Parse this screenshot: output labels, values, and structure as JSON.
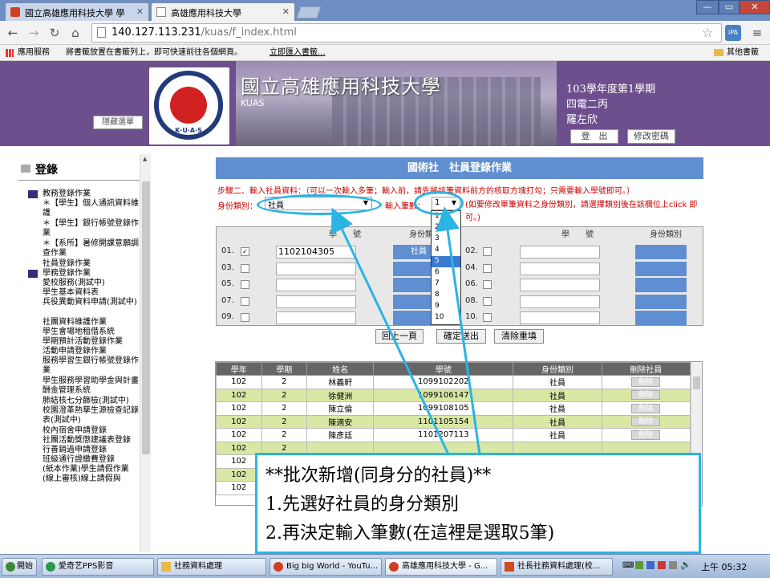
{
  "browser": {
    "tabs": [
      {
        "label": "國立高雄應用科技大學 學",
        "active": false
      },
      {
        "label": "高雄應用科技大學",
        "active": true
      }
    ],
    "window_buttons": [
      "—",
      "▭",
      "✕"
    ],
    "url_host": "140.127.113.231",
    "url_path": "/kuas/f_index.html",
    "bookmarks_bar": {
      "apps": "應用服務",
      "hint": "將書籤放置在書籤列上，即可快速前往各個網頁。",
      "import": "立即匯入書籤...",
      "other": "其他書籤"
    }
  },
  "banner": {
    "hide_menu": "隱藏選單",
    "uni_name": "國立高雄應用科技大學",
    "uni_abbr": "KUAS",
    "logo_letters": "K·U·A·S",
    "term": "103學年度第1學期",
    "class": "四電二丙",
    "user": "羅左欣",
    "logout": "登　出",
    "change_pw": "修改密碼"
  },
  "sidebar": {
    "title": "登錄",
    "items": [
      {
        "label": "教務登錄作業",
        "group": true
      },
      {
        "label": "＊【學生】個人通訊資料維護"
      },
      {
        "label": "＊【學生】銀行帳號登錄作業"
      },
      {
        "label": "＊【系所】暑修開課意願調查作業"
      },
      {
        "label": "社員登錄作業"
      },
      {
        "label": "學務登錄作業",
        "group": true
      },
      {
        "label": "愛校服務(測試中)"
      },
      {
        "label": "學生基本資料表"
      },
      {
        "label": "兵役異動資料申請(測試中)"
      },
      {
        "label": "社團資料維護作業"
      },
      {
        "label": "學生會場地租借系統"
      },
      {
        "label": "學期預計活動登錄作業"
      },
      {
        "label": "活動申請登錄作業"
      },
      {
        "label": "服務學習生銀行帳號登錄作業"
      },
      {
        "label": "學生服務學習助學金與計畫酬金管理系統"
      },
      {
        "label": "肺結核七分篩檢(測試中)"
      },
      {
        "label": "校園澄革熱孳生源檢查記錄表(測試中)"
      },
      {
        "label": "校內宿舍申請登錄"
      },
      {
        "label": "社團活動獎懲建議表登錄"
      },
      {
        "label": "行善銷過申請登錄"
      },
      {
        "label": "班級通行證繳費登錄"
      },
      {
        "label": "(紙本作業)學生請假作業"
      },
      {
        "label": "(線上審核)線上請假與"
      }
    ]
  },
  "form": {
    "title": "國術社　社員登錄作業",
    "step_text": "步驟二、輸入社員資料：（可以一次輸入多筆；輸入前，請先將該筆資料前方的核取方塊打勾；只需要輸入學號即可。）",
    "type_label": "身份類別：",
    "type_value": "社員",
    "count_label": "輸入筆數：",
    "count_value": "1",
    "count_hint": "(如要修改單筆資料之身份類別，請選擇類別後在該欄位上click 即可。)",
    "grid_headers": [
      "學　　號",
      "身份類別",
      "學　　號",
      "身份類別"
    ],
    "rows_left": [
      {
        "no": "01.",
        "checked": true,
        "sid": "1102104305",
        "type": "社員"
      },
      {
        "no": "03.",
        "checked": false,
        "sid": "",
        "type": ""
      },
      {
        "no": "05.",
        "checked": false,
        "sid": "",
        "type": ""
      },
      {
        "no": "07.",
        "checked": false,
        "sid": "",
        "type": ""
      },
      {
        "no": "09.",
        "checked": false,
        "sid": "",
        "type": ""
      }
    ],
    "rows_right": [
      {
        "no": "02.",
        "checked": false
      },
      {
        "no": "04.",
        "checked": false
      },
      {
        "no": "06.",
        "checked": false
      },
      {
        "no": "08.",
        "checked": false
      },
      {
        "no": "10.",
        "checked": false
      }
    ],
    "dropdown_options": [
      "1",
      "2",
      "3",
      "4",
      "5",
      "6",
      "7",
      "8",
      "9",
      "10"
    ],
    "dropdown_highlight": "5",
    "buttons": [
      "回上一頁",
      "確定送出",
      "清除重填"
    ]
  },
  "members": {
    "headers": [
      "學年",
      "學期",
      "姓名",
      "學號",
      "身份類別",
      "刪除社員"
    ],
    "rows": [
      [
        "102",
        "2",
        "林義軒",
        "1099102202",
        "社員",
        "刪除"
      ],
      [
        "102",
        "2",
        "徐健洲",
        "1099106147",
        "社員",
        "刪除"
      ],
      [
        "102",
        "2",
        "陳立倫",
        "1099108105",
        "社員",
        "刪除"
      ],
      [
        "102",
        "2",
        "陳適安",
        "1101105154",
        "社員",
        "刪除"
      ],
      [
        "102",
        "2",
        "陳彥廷",
        "1101207113",
        "社員",
        "刪除"
      ],
      [
        "102",
        "2",
        "",
        "",
        "",
        ""
      ],
      [
        "102",
        "2",
        "",
        "",
        "",
        ""
      ],
      [
        "102",
        "2",
        "",
        "",
        "",
        ""
      ],
      [
        "102",
        "2",
        "",
        "",
        "",
        ""
      ]
    ]
  },
  "callout": {
    "line1": "**批次新增(同身分的社員)**",
    "line2": "1.先選好社員的身分類別",
    "line3": "2.再決定輸入筆數(在這裡是選取5筆)"
  },
  "taskbar": {
    "start": "開始",
    "tasks": [
      "愛奇艺PPS影音",
      "社務資料處理",
      "Big big World - YouTu...",
      "高雄應用科技大學 - G...",
      "社長社務資料處理(校..."
    ],
    "clock": "上午 05:32"
  },
  "colors": {
    "banner": "#6e4f8e",
    "accent": "#2ab4e4",
    "header_blue": "#5f8fd0",
    "row_alt": "#d8e8a4"
  }
}
